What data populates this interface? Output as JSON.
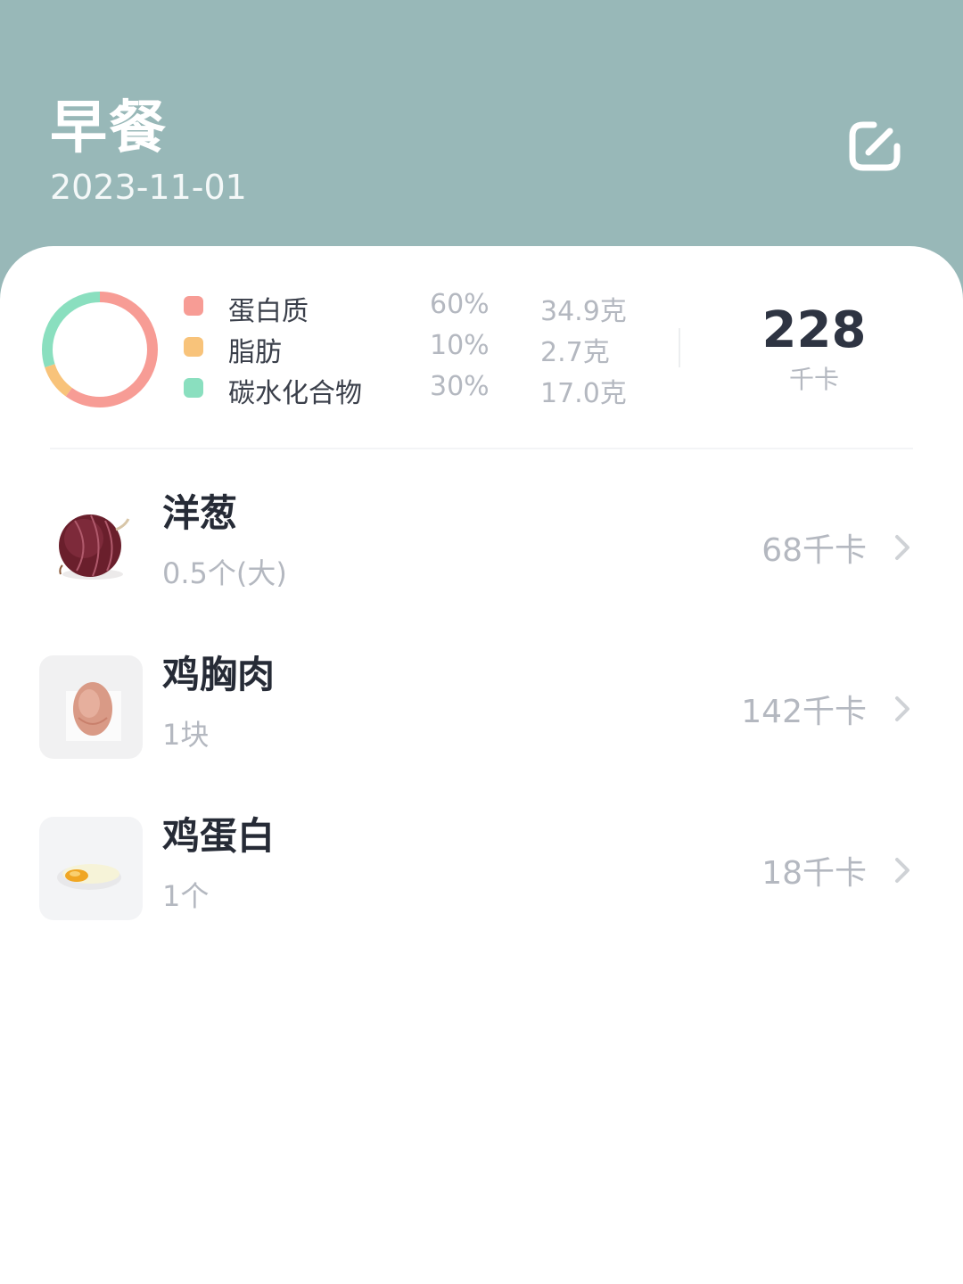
{
  "header": {
    "title": "早餐",
    "date": "2023-11-01",
    "edit_icon": "edit-icon",
    "background_color": "#98b8b8"
  },
  "nutrition": {
    "macros": [
      {
        "name": "蛋白质",
        "percent": "60%",
        "grams": "34.9克",
        "color": "#f79c95"
      },
      {
        "name": "脂肪",
        "percent": "10%",
        "grams": "2.7克",
        "color": "#f8c37a"
      },
      {
        "name": "碳水化合物",
        "percent": "30%",
        "grams": "17.0克",
        "color": "#8adfbf"
      }
    ],
    "total_value": "228",
    "total_unit": "千卡"
  },
  "foods": [
    {
      "name": "洋葱",
      "quantity": "0.5个(大)",
      "calories": "68千卡",
      "icon": "onion-photo"
    },
    {
      "name": "鸡胸肉",
      "quantity": "1块",
      "calories": "142千卡",
      "icon": "chicken-breast-photo"
    },
    {
      "name": "鸡蛋白",
      "quantity": "1个",
      "calories": "18千卡",
      "icon": "egg-white-photo"
    }
  ]
}
